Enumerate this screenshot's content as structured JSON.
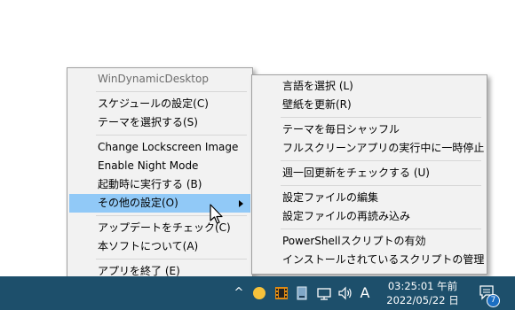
{
  "main_menu": {
    "title": "WinDynamicDesktop",
    "items": [
      {
        "label": "スケジュールの設定(C)"
      },
      {
        "label": "テーマを選択する(S)"
      },
      {
        "label": "Change Lockscreen Image"
      },
      {
        "label": "Enable Night Mode"
      },
      {
        "label": "起動時に実行する (B)"
      },
      {
        "label": "その他の設定(O)"
      },
      {
        "label": "アップデートをチェック(C)"
      },
      {
        "label": "本ソフトについて(A)"
      },
      {
        "label": "アプリを終了 (E)"
      }
    ]
  },
  "sub_menu": {
    "items": [
      {
        "label": "言語を選択 (L)"
      },
      {
        "label": "壁紙を更新(R)"
      },
      {
        "label": "テーマを毎日シャッフル"
      },
      {
        "label": "フルスクリーンアプリの実行中に一時停止"
      },
      {
        "label": "週一回更新をチェックする (U)"
      },
      {
        "label": "設定ファイルの編集"
      },
      {
        "label": "設定ファイルの再読み込み"
      },
      {
        "label": "PowerShellスクリプトの有効"
      },
      {
        "label": "インストールされているスクリプトの管理"
      }
    ]
  },
  "taskbar": {
    "chevron": "^",
    "ime": "A",
    "time": "03:25:01 午前",
    "date": "2022/05/22 日",
    "notification_count": "7",
    "color": "#1d4f6b"
  },
  "colors": {
    "menu_bg": "#f2f2f2",
    "highlight": "#91c9f7"
  }
}
